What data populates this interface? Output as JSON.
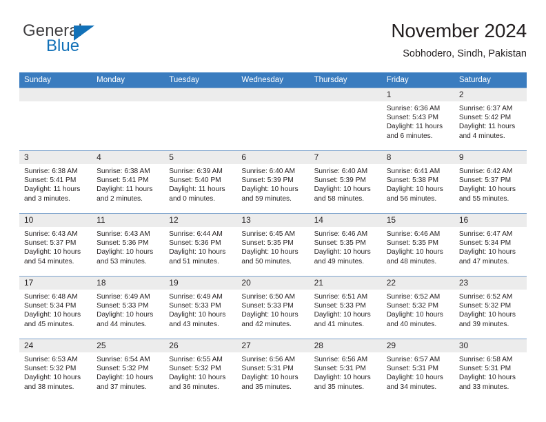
{
  "logo": {
    "word1": "General",
    "word2": "Blue"
  },
  "header": {
    "title": "November 2024",
    "subtitle": "Sobhodero, Sindh, Pakistan"
  },
  "calendar": {
    "weekday_headers": [
      "Sunday",
      "Monday",
      "Tuesday",
      "Wednesday",
      "Thursday",
      "Friday",
      "Saturday"
    ],
    "colors": {
      "header_bg": "#3a7cbf",
      "header_text": "#ffffff",
      "daynum_band_bg": "#ececec",
      "row_divider": "#7ba2cc",
      "text": "#231f20",
      "logo_blue": "#1271b8"
    },
    "weeks": [
      [
        {
          "day": "",
          "sunrise": "",
          "sunset": "",
          "daylight": ""
        },
        {
          "day": "",
          "sunrise": "",
          "sunset": "",
          "daylight": ""
        },
        {
          "day": "",
          "sunrise": "",
          "sunset": "",
          "daylight": ""
        },
        {
          "day": "",
          "sunrise": "",
          "sunset": "",
          "daylight": ""
        },
        {
          "day": "",
          "sunrise": "",
          "sunset": "",
          "daylight": ""
        },
        {
          "day": "1",
          "sunrise": "Sunrise: 6:36 AM",
          "sunset": "Sunset: 5:43 PM",
          "daylight": "Daylight: 11 hours and 6 minutes."
        },
        {
          "day": "2",
          "sunrise": "Sunrise: 6:37 AM",
          "sunset": "Sunset: 5:42 PM",
          "daylight": "Daylight: 11 hours and 4 minutes."
        }
      ],
      [
        {
          "day": "3",
          "sunrise": "Sunrise: 6:38 AM",
          "sunset": "Sunset: 5:41 PM",
          "daylight": "Daylight: 11 hours and 3 minutes."
        },
        {
          "day": "4",
          "sunrise": "Sunrise: 6:38 AM",
          "sunset": "Sunset: 5:41 PM",
          "daylight": "Daylight: 11 hours and 2 minutes."
        },
        {
          "day": "5",
          "sunrise": "Sunrise: 6:39 AM",
          "sunset": "Sunset: 5:40 PM",
          "daylight": "Daylight: 11 hours and 0 minutes."
        },
        {
          "day": "6",
          "sunrise": "Sunrise: 6:40 AM",
          "sunset": "Sunset: 5:39 PM",
          "daylight": "Daylight: 10 hours and 59 minutes."
        },
        {
          "day": "7",
          "sunrise": "Sunrise: 6:40 AM",
          "sunset": "Sunset: 5:39 PM",
          "daylight": "Daylight: 10 hours and 58 minutes."
        },
        {
          "day": "8",
          "sunrise": "Sunrise: 6:41 AM",
          "sunset": "Sunset: 5:38 PM",
          "daylight": "Daylight: 10 hours and 56 minutes."
        },
        {
          "day": "9",
          "sunrise": "Sunrise: 6:42 AM",
          "sunset": "Sunset: 5:37 PM",
          "daylight": "Daylight: 10 hours and 55 minutes."
        }
      ],
      [
        {
          "day": "10",
          "sunrise": "Sunrise: 6:43 AM",
          "sunset": "Sunset: 5:37 PM",
          "daylight": "Daylight: 10 hours and 54 minutes."
        },
        {
          "day": "11",
          "sunrise": "Sunrise: 6:43 AM",
          "sunset": "Sunset: 5:36 PM",
          "daylight": "Daylight: 10 hours and 53 minutes."
        },
        {
          "day": "12",
          "sunrise": "Sunrise: 6:44 AM",
          "sunset": "Sunset: 5:36 PM",
          "daylight": "Daylight: 10 hours and 51 minutes."
        },
        {
          "day": "13",
          "sunrise": "Sunrise: 6:45 AM",
          "sunset": "Sunset: 5:35 PM",
          "daylight": "Daylight: 10 hours and 50 minutes."
        },
        {
          "day": "14",
          "sunrise": "Sunrise: 6:46 AM",
          "sunset": "Sunset: 5:35 PM",
          "daylight": "Daylight: 10 hours and 49 minutes."
        },
        {
          "day": "15",
          "sunrise": "Sunrise: 6:46 AM",
          "sunset": "Sunset: 5:35 PM",
          "daylight": "Daylight: 10 hours and 48 minutes."
        },
        {
          "day": "16",
          "sunrise": "Sunrise: 6:47 AM",
          "sunset": "Sunset: 5:34 PM",
          "daylight": "Daylight: 10 hours and 47 minutes."
        }
      ],
      [
        {
          "day": "17",
          "sunrise": "Sunrise: 6:48 AM",
          "sunset": "Sunset: 5:34 PM",
          "daylight": "Daylight: 10 hours and 45 minutes."
        },
        {
          "day": "18",
          "sunrise": "Sunrise: 6:49 AM",
          "sunset": "Sunset: 5:33 PM",
          "daylight": "Daylight: 10 hours and 44 minutes."
        },
        {
          "day": "19",
          "sunrise": "Sunrise: 6:49 AM",
          "sunset": "Sunset: 5:33 PM",
          "daylight": "Daylight: 10 hours and 43 minutes."
        },
        {
          "day": "20",
          "sunrise": "Sunrise: 6:50 AM",
          "sunset": "Sunset: 5:33 PM",
          "daylight": "Daylight: 10 hours and 42 minutes."
        },
        {
          "day": "21",
          "sunrise": "Sunrise: 6:51 AM",
          "sunset": "Sunset: 5:33 PM",
          "daylight": "Daylight: 10 hours and 41 minutes."
        },
        {
          "day": "22",
          "sunrise": "Sunrise: 6:52 AM",
          "sunset": "Sunset: 5:32 PM",
          "daylight": "Daylight: 10 hours and 40 minutes."
        },
        {
          "day": "23",
          "sunrise": "Sunrise: 6:52 AM",
          "sunset": "Sunset: 5:32 PM",
          "daylight": "Daylight: 10 hours and 39 minutes."
        }
      ],
      [
        {
          "day": "24",
          "sunrise": "Sunrise: 6:53 AM",
          "sunset": "Sunset: 5:32 PM",
          "daylight": "Daylight: 10 hours and 38 minutes."
        },
        {
          "day": "25",
          "sunrise": "Sunrise: 6:54 AM",
          "sunset": "Sunset: 5:32 PM",
          "daylight": "Daylight: 10 hours and 37 minutes."
        },
        {
          "day": "26",
          "sunrise": "Sunrise: 6:55 AM",
          "sunset": "Sunset: 5:32 PM",
          "daylight": "Daylight: 10 hours and 36 minutes."
        },
        {
          "day": "27",
          "sunrise": "Sunrise: 6:56 AM",
          "sunset": "Sunset: 5:31 PM",
          "daylight": "Daylight: 10 hours and 35 minutes."
        },
        {
          "day": "28",
          "sunrise": "Sunrise: 6:56 AM",
          "sunset": "Sunset: 5:31 PM",
          "daylight": "Daylight: 10 hours and 35 minutes."
        },
        {
          "day": "29",
          "sunrise": "Sunrise: 6:57 AM",
          "sunset": "Sunset: 5:31 PM",
          "daylight": "Daylight: 10 hours and 34 minutes."
        },
        {
          "day": "30",
          "sunrise": "Sunrise: 6:58 AM",
          "sunset": "Sunset: 5:31 PM",
          "daylight": "Daylight: 10 hours and 33 minutes."
        }
      ]
    ]
  }
}
